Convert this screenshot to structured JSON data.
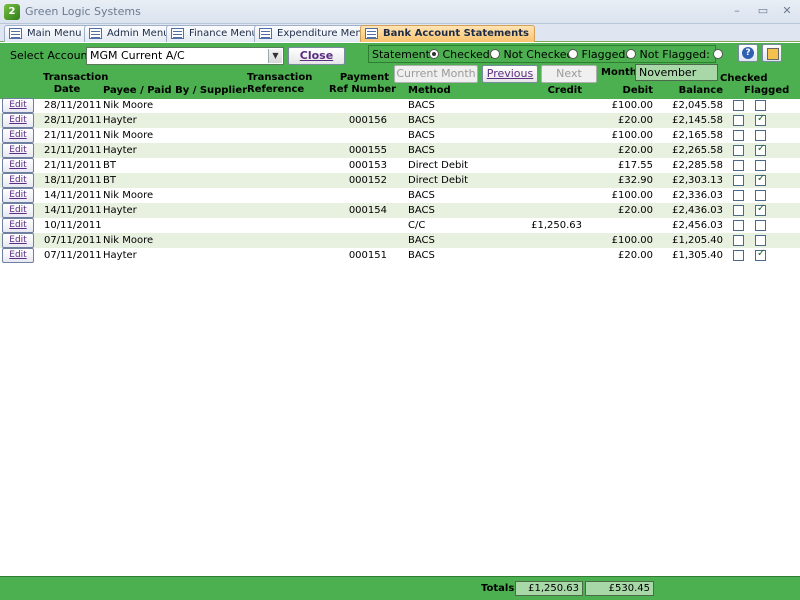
{
  "window": {
    "title": "Green Logic Systems",
    "minimize": "–",
    "maximize": "▭",
    "close": "✕"
  },
  "tabs": [
    {
      "label": "Main Menu"
    },
    {
      "label": "Admin Menu"
    },
    {
      "label": "Finance Menu"
    },
    {
      "label": "Expenditure Menu"
    },
    {
      "label": "Bank Account Statements",
      "active": true
    }
  ],
  "header": {
    "select_account_label": "Select Account:",
    "account_value": "MGM Current A/C",
    "close_label": "Close",
    "statement_label": "Statement:",
    "filter_options": [
      "Checked:",
      "Not Checked",
      "Flagged:",
      "Not Flagged:"
    ],
    "selected_filter": 0,
    "current_month_label": "Current Month",
    "previous_label": "Previous",
    "next_label": "Next",
    "month_label": "Month:",
    "month_value": "November"
  },
  "columns": {
    "date": [
      "Transaction",
      "Date"
    ],
    "payee": "Payee / Paid By / Supplier",
    "reference": [
      "Transaction",
      "Reference"
    ],
    "payment_ref": [
      "Payment",
      "Ref Number"
    ],
    "method": "Method",
    "credit": "Credit",
    "debit": "Debit",
    "balance": "Balance",
    "checked": "Checked",
    "flagged": "Flagged"
  },
  "edit_label": "Edit",
  "rows": [
    {
      "date": "28/11/2011",
      "payee": "Nik Moore",
      "ref": "",
      "payment_ref": "",
      "method": "BACS",
      "credit": "",
      "debit": "£100.00",
      "balance": "£2,045.58",
      "checked": false,
      "flagged": false
    },
    {
      "date": "28/11/2011",
      "payee": "Hayter",
      "ref": "",
      "payment_ref": "000156",
      "method": "BACS",
      "credit": "",
      "debit": "£20.00",
      "balance": "£2,145.58",
      "checked": false,
      "flagged": true
    },
    {
      "date": "21/11/2011",
      "payee": "Nik Moore",
      "ref": "",
      "payment_ref": "",
      "method": "BACS",
      "credit": "",
      "debit": "£100.00",
      "balance": "£2,165.58",
      "checked": false,
      "flagged": false
    },
    {
      "date": "21/11/2011",
      "payee": "Hayter",
      "ref": "",
      "payment_ref": "000155",
      "method": "BACS",
      "credit": "",
      "debit": "£20.00",
      "balance": "£2,265.58",
      "checked": false,
      "flagged": true
    },
    {
      "date": "21/11/2011",
      "payee": "BT",
      "ref": "",
      "payment_ref": "000153",
      "method": "Direct Debit",
      "credit": "",
      "debit": "£17.55",
      "balance": "£2,285.58",
      "checked": false,
      "flagged": false
    },
    {
      "date": "18/11/2011",
      "payee": "BT",
      "ref": "",
      "payment_ref": "000152",
      "method": "Direct Debit",
      "credit": "",
      "debit": "£32.90",
      "balance": "£2,303.13",
      "checked": false,
      "flagged": true
    },
    {
      "date": "14/11/2011",
      "payee": "Nik Moore",
      "ref": "",
      "payment_ref": "",
      "method": "BACS",
      "credit": "",
      "debit": "£100.00",
      "balance": "£2,336.03",
      "checked": false,
      "flagged": false
    },
    {
      "date": "14/11/2011",
      "payee": "Hayter",
      "ref": "",
      "payment_ref": "000154",
      "method": "BACS",
      "credit": "",
      "debit": "£20.00",
      "balance": "£2,436.03",
      "checked": false,
      "flagged": true
    },
    {
      "date": "10/11/2011",
      "payee": "",
      "ref": "",
      "payment_ref": "",
      "method": "C/C",
      "credit": "£1,250.63",
      "debit": "",
      "balance": "£2,456.03",
      "checked": false,
      "flagged": false
    },
    {
      "date": "07/11/2011",
      "payee": "Nik Moore",
      "ref": "",
      "payment_ref": "",
      "method": "BACS",
      "credit": "",
      "debit": "£100.00",
      "balance": "£1,205.40",
      "checked": false,
      "flagged": false
    },
    {
      "date": "07/11/2011",
      "payee": "Hayter",
      "ref": "",
      "payment_ref": "000151",
      "method": "BACS",
      "credit": "",
      "debit": "£20.00",
      "balance": "£1,305.40",
      "checked": false,
      "flagged": true
    }
  ],
  "footer": {
    "totals_label": "Totals:",
    "credit_total": "£1,250.63",
    "debit_total": "£530.45"
  },
  "colors": {
    "accent_green": "#4caf50",
    "active_tab": "#f9c36d",
    "alt_row": "#e8f0e0"
  }
}
